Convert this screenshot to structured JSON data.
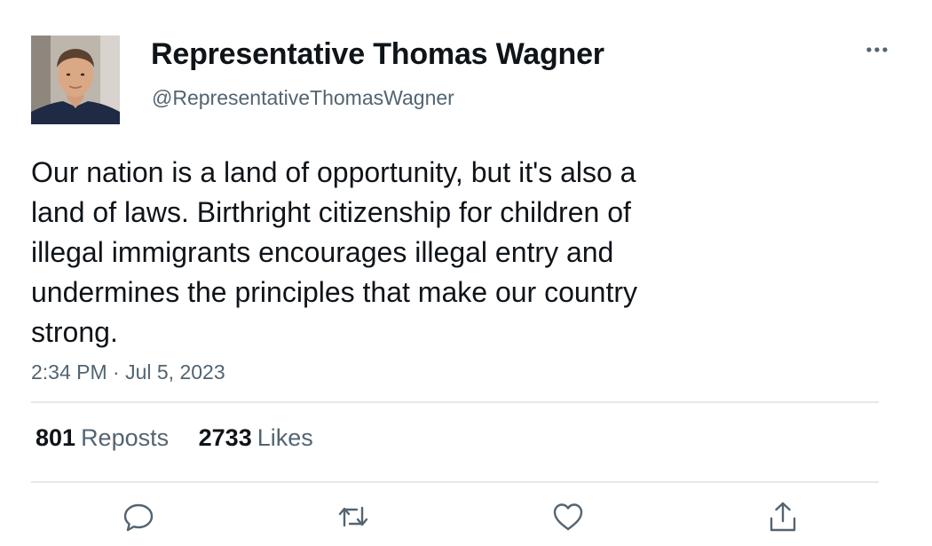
{
  "author": {
    "display_name": "Representative Thomas Wagner",
    "handle": "@RepresentativeThomasWagner",
    "avatar_icon": "profile-photo"
  },
  "more_icon": "more-horizontal-icon",
  "tweet": {
    "lines": [
      "Our nation is a land of opportunity, but it's also a",
      "land of laws. Birthright citizenship for children of",
      "illegal immigrants encourages illegal entry and",
      "undermines the principles that make our country",
      "strong."
    ],
    "timestamp": "2:34 PM · Jul 5, 2023"
  },
  "stats": {
    "reposts_count": "801",
    "reposts_label": "Reposts",
    "likes_count": "2733",
    "likes_label": "Likes"
  },
  "actions": {
    "reply_icon": "reply-icon",
    "repost_icon": "repost-icon",
    "like_icon": "like-icon",
    "share_icon": "share-icon"
  },
  "colors": {
    "text_primary": "#0f1419",
    "text_secondary": "#536471",
    "divider": "#e6e9eb",
    "icon": "#536471"
  }
}
